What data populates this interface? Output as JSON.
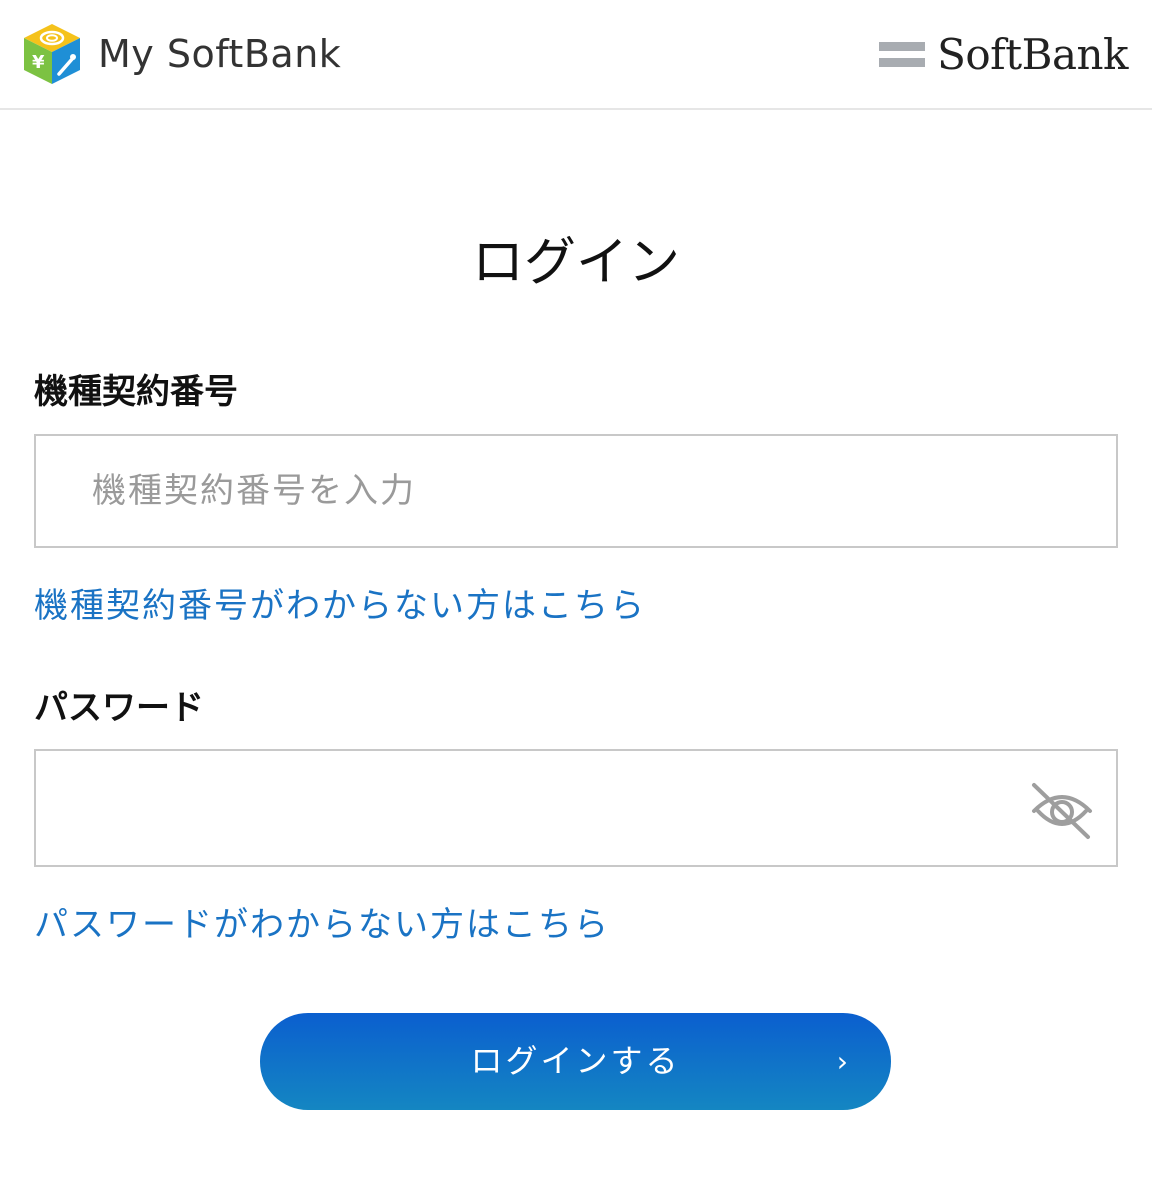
{
  "header": {
    "app_name": "My SoftBank",
    "brand_name": "SoftBank"
  },
  "page": {
    "title": "ログイン"
  },
  "form": {
    "contract_label": "機種契約番号",
    "contract_placeholder": "機種契約番号を入力",
    "contract_value": "",
    "contract_help_link": "機種契約番号がわからない方はこちら",
    "password_label": "パスワード",
    "password_value": "",
    "password_help_link": "パスワードがわからない方はこちら",
    "submit_label": "ログインする",
    "submit_chevron": "›"
  },
  "icons": {
    "logo": "my-softbank-cube-icon",
    "brand": "softbank-bars-icon",
    "password_toggle": "eye-slash-icon",
    "submit": "chevron-right-icon"
  },
  "colors": {
    "link": "#1a73c4",
    "button_top": "#0b5fcf",
    "button_bottom": "#1486c2",
    "field_border": "#c8c8c8",
    "placeholder": "#9a9a9a"
  }
}
